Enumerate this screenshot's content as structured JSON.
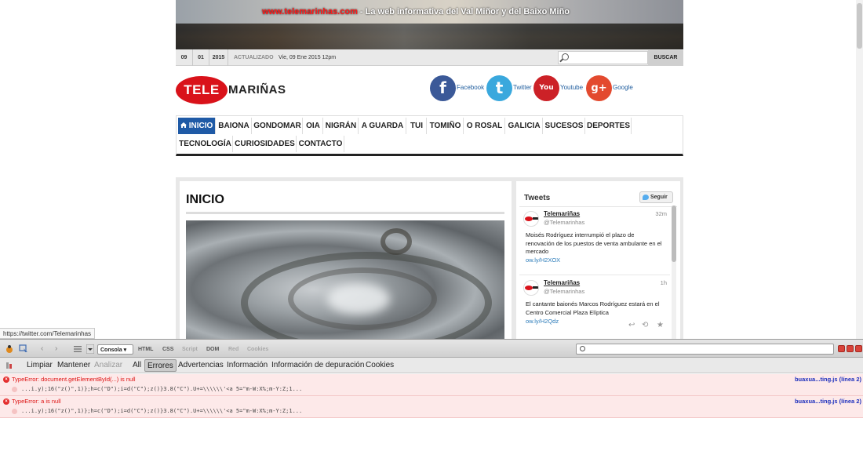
{
  "banner": {
    "url": "www.telemarinhas.com",
    "tagline": " - La web informativa del Val Miñor y del Baixo Miño"
  },
  "datebar": {
    "day": "09",
    "month": "01",
    "year": "2015",
    "updated_label": "ACTUALIZADO",
    "updated_value": "Vie, 09 Ene 2015 12pm",
    "search_button": "BUSCAR"
  },
  "logo": {
    "left": "TELE",
    "right": "MARIÑAS"
  },
  "social": [
    {
      "label": "Facebook",
      "glyph": "f",
      "color": "#3b5998"
    },
    {
      "label": "Twitter",
      "glyph": "t",
      "color": "#3aa8dd"
    },
    {
      "label": "Youtube",
      "glyph": "You",
      "color": "#cc2127"
    },
    {
      "label": "Google",
      "glyph": "g+",
      "color": "#e34a2f"
    }
  ],
  "nav": [
    "INICIO",
    "BAIONA",
    "GONDOMAR",
    "OIA",
    "NIGRÁN",
    "A GUARDA",
    "TUI",
    "TOMIÑO",
    "O ROSAL",
    "GALICIA",
    "SUCESOS",
    "DEPORTES",
    "TECNOLOGÍA",
    "CURIOSIDADES",
    "CONTACTO"
  ],
  "main": {
    "title": "INICIO"
  },
  "tweets": {
    "header": "Tweets",
    "follow": "Seguir",
    "items": [
      {
        "name": "Telemariñas",
        "handle": "@Telemarinhas",
        "time": "32m",
        "text": "Moisés Rodríguez interrumpió el plazo de renovación de los puestos de venta ambulante en el mercado",
        "link": "ow.ly/H2XOX"
      },
      {
        "name": "Telemariñas",
        "handle": "@Telemarinhas",
        "time": "1h",
        "text": "El cantante baionés Marcos Rodríguez estará en el Centro Comercial Plaza Elíptica",
        "link": "ow.ly/H2Qdz"
      }
    ]
  },
  "status_url": "https://twitter.com/Telemarinhas",
  "devtools": {
    "tabs": [
      "Consola",
      "HTML",
      "CSS",
      "Script",
      "DOM",
      "Red",
      "Cookies"
    ],
    "filters": [
      "Limpiar",
      "Mantener",
      "Analizar",
      "All",
      "Errores",
      "Advertencias",
      "Información",
      "Información de depuración",
      "Cookies"
    ],
    "errors": [
      {
        "message": "TypeError: document.getElementById(...) is null",
        "source": "buaxua...ting.js (línea 2)",
        "code": "...i.y);16(\"z()\",1)};h=c(\"D\");i=d(\"C\");z()}3.8(\"C\").U+=\\\\\\\\\\\\'<a 5=\"m-W:X%;m-Y:Z;1..."
      },
      {
        "message": "TypeError: a is null",
        "source": "buaxua...ting.js (línea 2)",
        "code": "...i.y);16(\"z()\",1)};h=c(\"D\");i=d(\"C\");z()}3.8(\"C\").U+=\\\\\\\\\\\\'<a 5=\"m-W:X%;m-Y:Z;1..."
      }
    ]
  }
}
